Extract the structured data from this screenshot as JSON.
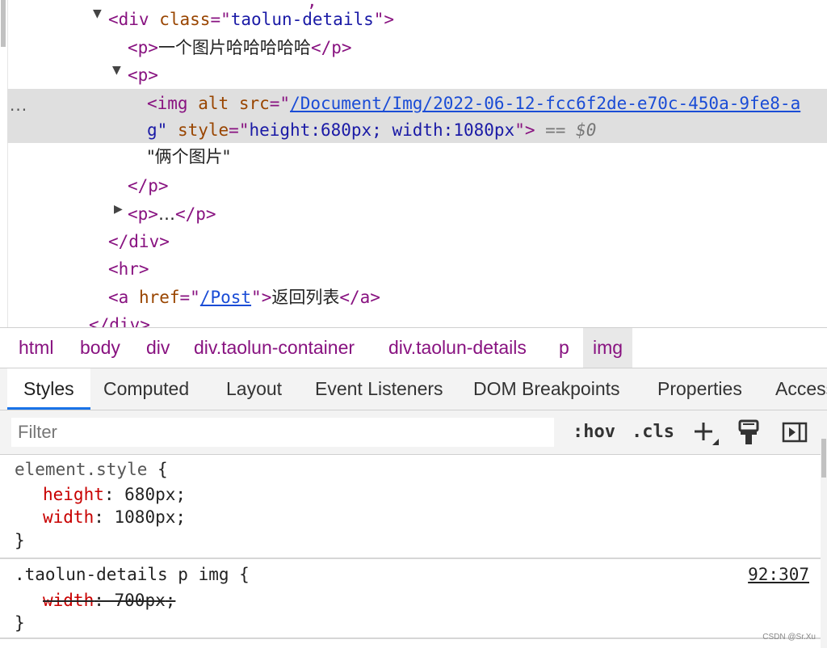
{
  "elements_tree": {
    "row0": {
      "tag_open": "<div",
      "attr": "class",
      "eq": "=\"",
      "val": "taolun-details",
      "close": "\">"
    },
    "row1": {
      "open": "<p>",
      "text": "一个图片哈哈哈哈哈",
      "close": "</p>"
    },
    "row2": {
      "open": "<p>"
    },
    "row3": {
      "open": "<img",
      "attr1": "alt",
      "attr2": "src",
      "eq": "=\"",
      "link": "/Document/Img/2022-06-12-fcc6f2de-e70c-450a-9fe8-a",
      "dots": "..."
    },
    "row4": {
      "cont": "g\"",
      "attr": "style",
      "eq": "=\"",
      "val": "height:680px; width:1080px",
      "close": "\">",
      "marker": "== $0"
    },
    "row5": {
      "text": "\"俩个图片\""
    },
    "row6": {
      "close": "</p>"
    },
    "row7": {
      "open": "<p>",
      "ellipsis": "…",
      "close": "</p>"
    },
    "row8": {
      "close": "</div>"
    },
    "row9": {
      "open": "<hr>"
    },
    "row10": {
      "open": "<a",
      "attr": "href",
      "eq": "=\"",
      "link": "/Post",
      "close": "\">",
      "text": "返回列表",
      "end": "</a>"
    },
    "row11": {
      "close": "</div>"
    }
  },
  "breadcrumb": [
    "html",
    "body",
    "div",
    "div.taolun-container",
    "div.taolun-details",
    "p",
    "img"
  ],
  "tabs": [
    "Styles",
    "Computed",
    "Layout",
    "Event Listeners",
    "DOM Breakpoints",
    "Properties",
    "Access"
  ],
  "filter": {
    "placeholder": "Filter",
    "hov": ":hov",
    "cls": ".cls"
  },
  "styles": {
    "element_style": {
      "selector": "element.style",
      "open": "{",
      "props": [
        {
          "name": "height",
          "value": "680px"
        },
        {
          "name": "width",
          "value": "1080px"
        }
      ],
      "close": "}"
    },
    "rule2": {
      "selector": ".taolun-details p img",
      "open": "{",
      "source": "92:307",
      "props": [
        {
          "name": "width",
          "value": "700px"
        }
      ],
      "close": "}"
    }
  },
  "watermark": "CSDN @Sr.Xu",
  "colors": {
    "tag": "#881280",
    "attr": "#994500",
    "value": "#1a1aa6",
    "link": "#1a4cd6",
    "accent": "#1a73e8",
    "prop": "#c80000"
  },
  "icons": [
    "expanded-triangle-icon",
    "collapsed-triangle-icon",
    "plus-icon",
    "paint-brush-icon",
    "toggle-sidebar-icon"
  ]
}
